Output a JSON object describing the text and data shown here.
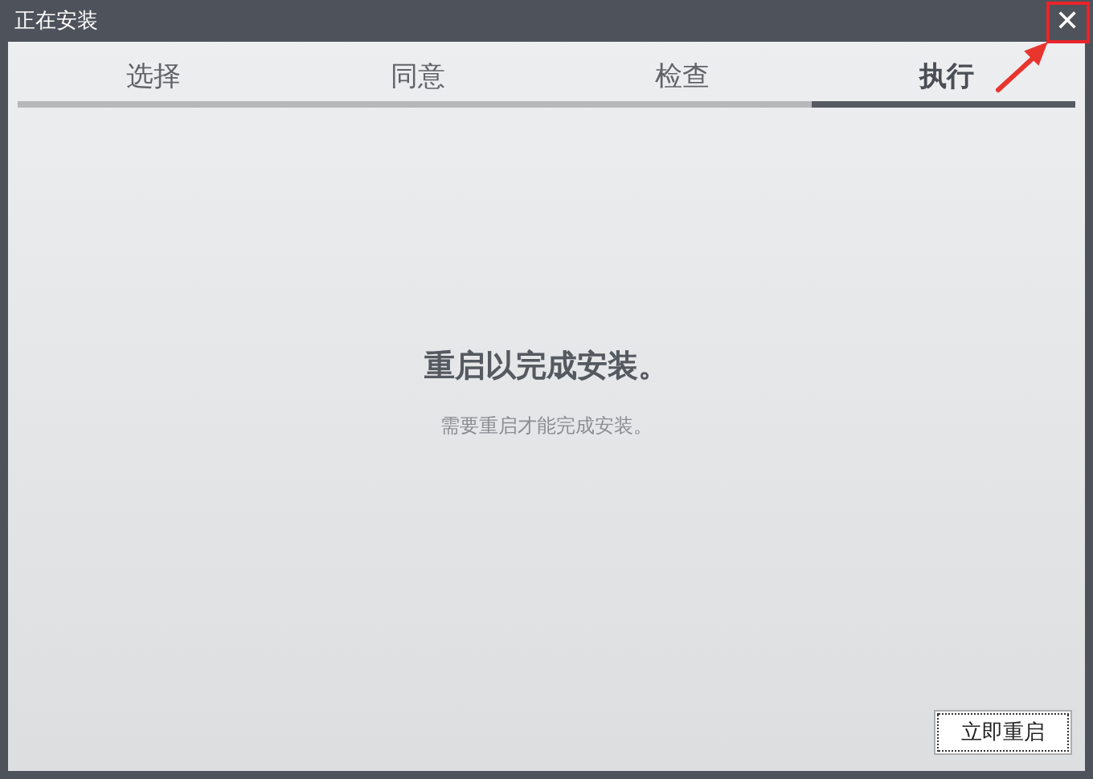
{
  "window": {
    "title": "正在安装",
    "close": "✕"
  },
  "steps": [
    {
      "label": "选择",
      "selected": false
    },
    {
      "label": "同意",
      "selected": false
    },
    {
      "label": "检查",
      "selected": false
    },
    {
      "label": "执行",
      "selected": true
    }
  ],
  "message": {
    "heading": "重启以完成安装。",
    "detail": "需要重启才能完成安装。"
  },
  "button": {
    "label": "立即重启",
    "focused": true
  }
}
